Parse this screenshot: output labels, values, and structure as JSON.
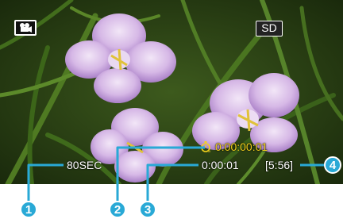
{
  "osd": {
    "mode_icon": "video-camera-icon",
    "quality_badge": "SD",
    "interval_setting": "80SEC",
    "recording_time": "0:00:00:01",
    "elapsed_time": "0:00:01",
    "remaining_time": "[5:56]",
    "stopwatch_icon": "stopwatch-icon"
  },
  "callouts": {
    "marker_1": "1",
    "marker_2": "2",
    "marker_3": "3",
    "marker_4": "4",
    "color": "#29a9d6"
  },
  "colors": {
    "recording_time": "#f5d31b",
    "overlay_text": "#ffffff"
  }
}
